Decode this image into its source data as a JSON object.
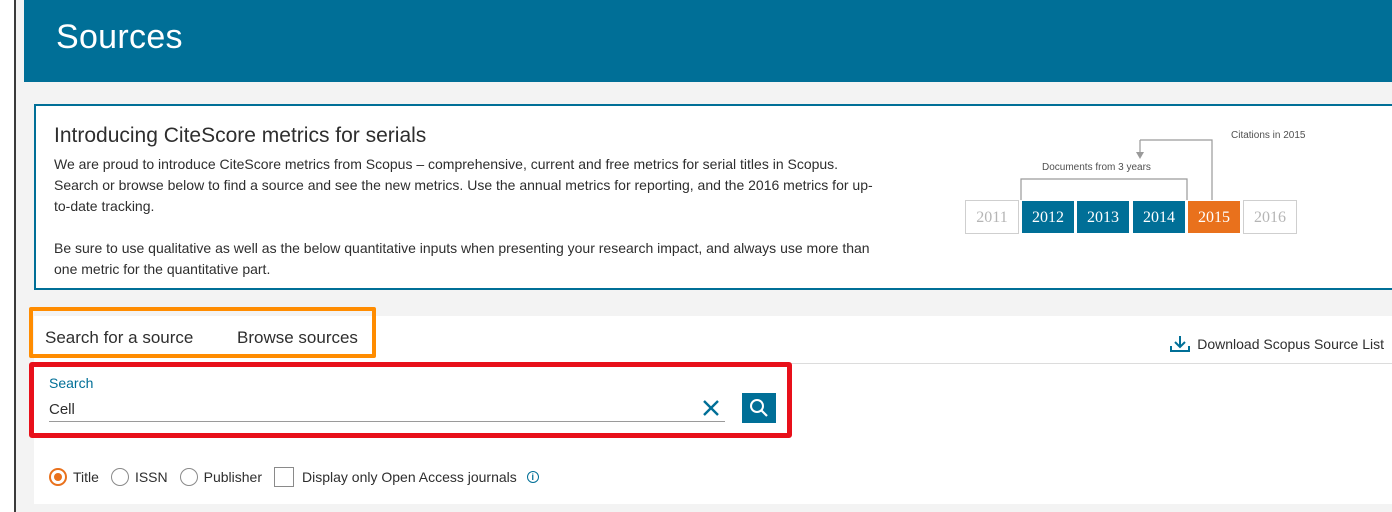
{
  "header": {
    "title": "Sources"
  },
  "intro": {
    "title": "Introducing CiteScore metrics for serials",
    "paragraph1": "We are proud to introduce CiteScore metrics from Scopus – comprehensive, current and free metrics for serial titles in Scopus. Search or browse below to find a source and see the new metrics. Use the annual metrics for reporting, and the 2016 metrics for up-to-date tracking.",
    "paragraph2": "Be sure to use qualitative as well as the below quantitative inputs when presenting your research impact, and always use more than one metric for the quantitative part.",
    "graphic": {
      "citations_label": "Citations in 2015",
      "documents_label": "Documents from 3 years",
      "years": [
        "2011",
        "2012",
        "2013",
        "2014",
        "2015",
        "2016"
      ],
      "colors": {
        "documents": "#006f97",
        "citations": "#e9711c",
        "inactive": "#b5b5b5"
      }
    }
  },
  "tabs": [
    {
      "label": "Search for a source"
    },
    {
      "label": "Browse sources"
    }
  ],
  "download": {
    "label": "Download Scopus Source List",
    "icon": "download-icon"
  },
  "search": {
    "label": "Search",
    "value": "Cell",
    "clear_icon": "close-icon",
    "submit_icon": "search-icon"
  },
  "options": {
    "radios": [
      {
        "label": "Title",
        "checked": true
      },
      {
        "label": "ISSN",
        "checked": false
      },
      {
        "label": "Publisher",
        "checked": false
      }
    ],
    "open_access_label": "Display only Open Access journals",
    "info_icon": "info-icon"
  },
  "highlights": {
    "orange": "#ff8c00",
    "red": "#e8101a"
  }
}
